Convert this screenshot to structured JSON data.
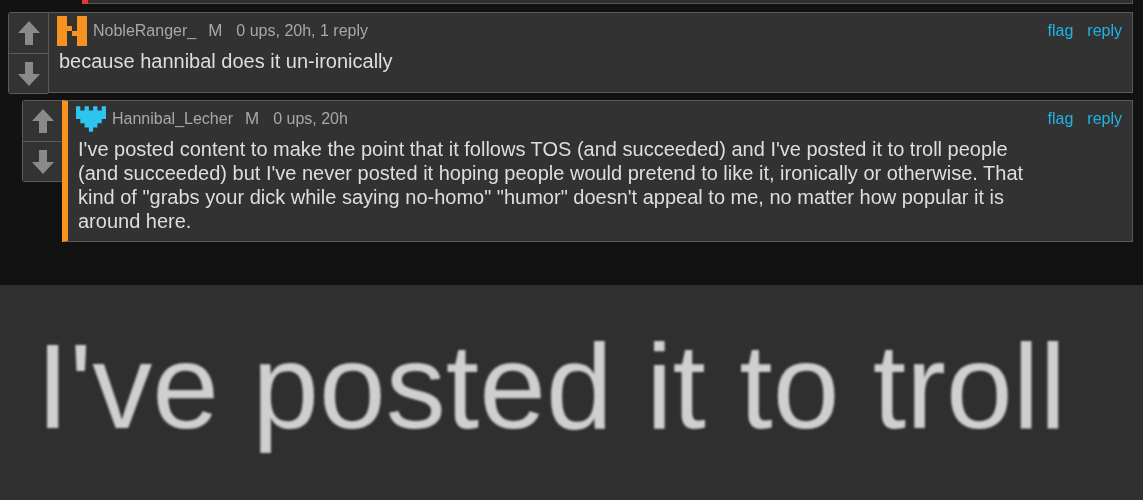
{
  "previous_comment": {
    "color": "#e53935"
  },
  "comments": [
    {
      "kind": "h",
      "username": "NobleRanger_",
      "badge": "M",
      "meta": "0 ups, 20h, 1 reply",
      "actions": [
        "flag",
        "reply"
      ],
      "body": "because hannibal does it un-ironically",
      "nested": false
    },
    {
      "kind": "pixel",
      "username": "Hannibal_Lecher",
      "badge": "M",
      "meta": "0 ups, 20h",
      "actions": [
        "flag",
        "reply"
      ],
      "body": "I've posted content to make the point that it follows TOS (and succeeded) and I've posted it to troll people (and succeeded) but I've never posted it hoping people would pretend to like it, ironically or otherwise. That kind of \"grabs your dick while saying no-homo\" \"humor\" doesn't appeal to me, no matter how popular it is around here.",
      "nested": true,
      "color": "#f7931e"
    }
  ],
  "zoomed_text": "I've posted it to troll"
}
